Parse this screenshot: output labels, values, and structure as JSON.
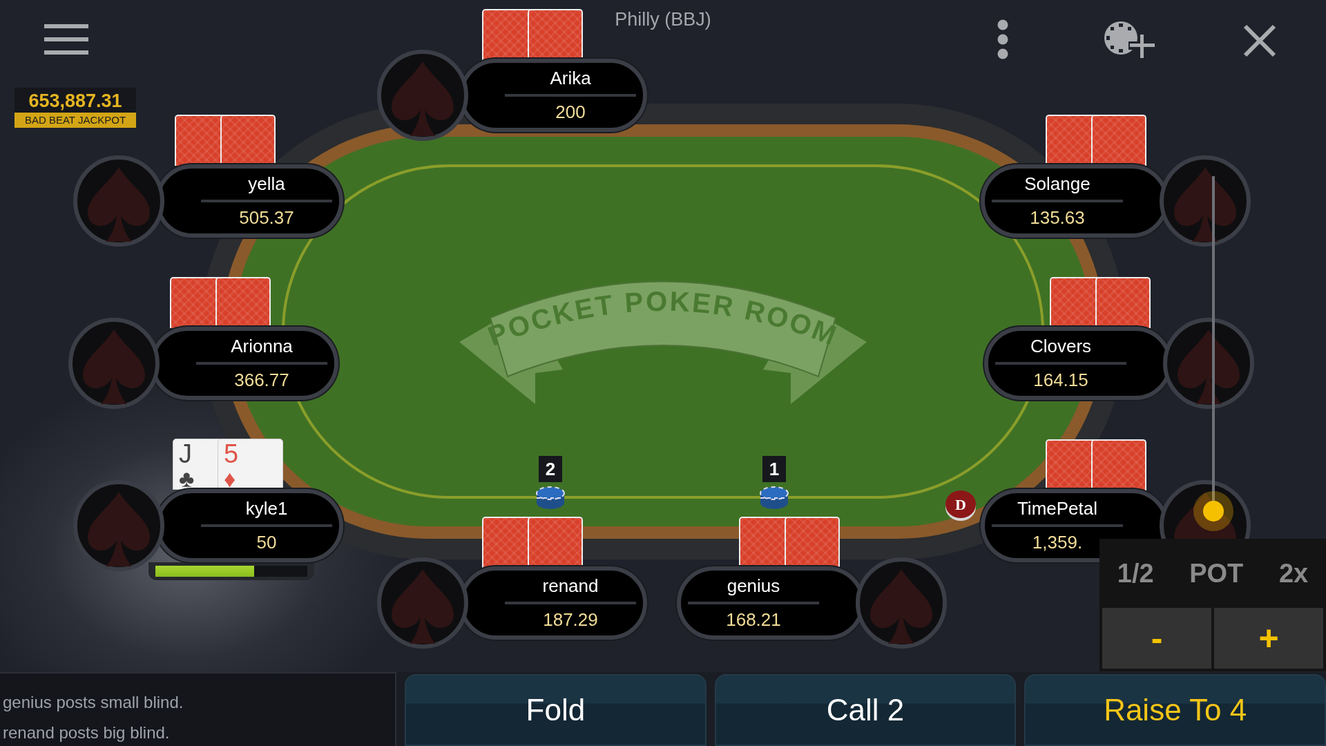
{
  "title": "Philly (BBJ)",
  "jackpot": {
    "amount": "653,887.31",
    "label": "BAD BEAT JACKPOT"
  },
  "table": {
    "logo": "POCKET POKER ROOM"
  },
  "seats": [
    {
      "name": "Arika",
      "stack": "200",
      "cards": [
        {
          "kind": "back"
        },
        {
          "kind": "back"
        }
      ]
    },
    {
      "name": "yella",
      "stack": "505.37",
      "cards": [
        {
          "kind": "back"
        },
        {
          "kind": "back"
        }
      ]
    },
    {
      "name": "Arionna",
      "stack": "366.77",
      "cards": [
        {
          "kind": "back"
        },
        {
          "kind": "back"
        }
      ]
    },
    {
      "name": "kyle1",
      "stack": "50",
      "cards": [
        {
          "kind": "face",
          "rank": "J",
          "suit": "♣",
          "red": false
        },
        {
          "kind": "face",
          "rank": "5",
          "suit": "♦",
          "red": true
        }
      ],
      "timer": {
        "level": 0.65
      }
    },
    {
      "name": "renand",
      "stack": "187.29",
      "cards": [
        {
          "kind": "back"
        },
        {
          "kind": "back"
        }
      ]
    },
    {
      "name": "genius",
      "stack": "168.21",
      "cards": [
        {
          "kind": "back"
        },
        {
          "kind": "back"
        }
      ]
    },
    {
      "name": "Solange",
      "stack": "135.63",
      "cards": [
        {
          "kind": "back"
        },
        {
          "kind": "back"
        }
      ]
    },
    {
      "name": "Clovers",
      "stack": "164.15",
      "cards": [
        {
          "kind": "back"
        },
        {
          "kind": "back"
        }
      ]
    },
    {
      "name": "TimePetal",
      "stack": "1,359.",
      "cards": [
        {
          "kind": "back"
        },
        {
          "kind": "back"
        }
      ]
    }
  ],
  "bets": [
    {
      "amount": "2"
    },
    {
      "amount": "1"
    }
  ],
  "dealer_button": "D",
  "bet_slider": {
    "level": 0
  },
  "bet_presets": [
    "1/2",
    "POT",
    "2x"
  ],
  "steppers": [
    "-",
    "+"
  ],
  "log": [
    "genius posts small blind.",
    "renand posts big blind."
  ],
  "actions": [
    {
      "label": "Fold",
      "kind": "fold"
    },
    {
      "label": "Call 2",
      "kind": "call"
    },
    {
      "label": "Raise To 4",
      "kind": "raise"
    }
  ]
}
